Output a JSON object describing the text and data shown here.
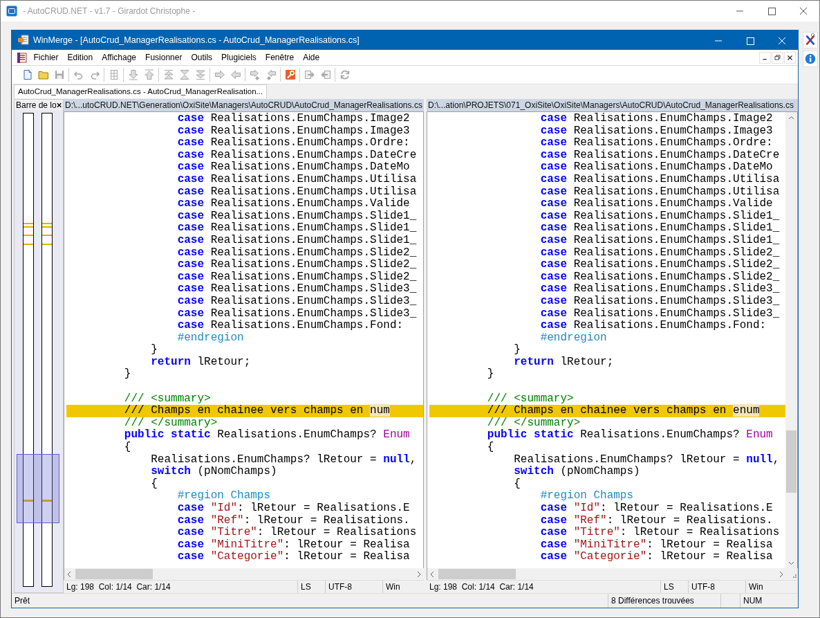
{
  "app_window": {
    "title": "- AutoCRUD.NET - v1.7 - Girardot Christophe -"
  },
  "side_tools": [
    {
      "kind": "tools"
    },
    {
      "kind": "info"
    }
  ],
  "winmerge": {
    "title": "WinMerge - [AutoCrud_ManagerRealisations.cs - AutoCrud_ManagerRealisations.cs]",
    "menu": [
      "Fichier",
      "Edition",
      "Affichage",
      "Fusionner",
      "Outils",
      "Plugiciels",
      "Fenêtre",
      "Aide"
    ],
    "toolbar": [
      [
        {
          "kind": "new",
          "disabled": false
        },
        {
          "kind": "open",
          "disabled": false
        },
        {
          "kind": "save",
          "disabled": true
        }
      ],
      [
        {
          "kind": "undo",
          "disabled": true
        },
        {
          "kind": "redo",
          "disabled": true
        }
      ],
      [
        {
          "kind": "columns",
          "disabled": true
        }
      ],
      [
        {
          "kind": "down",
          "disabled": true
        },
        {
          "kind": "up",
          "disabled": true
        }
      ],
      [
        {
          "kind": "first",
          "disabled": true
        },
        {
          "kind": "current",
          "disabled": true
        },
        {
          "kind": "last",
          "disabled": true
        }
      ],
      [
        {
          "kind": "right",
          "disabled": true
        },
        {
          "kind": "left",
          "disabled": true
        }
      ],
      [
        {
          "kind": "right-next",
          "disabled": true
        },
        {
          "kind": "left-next",
          "disabled": true
        }
      ],
      [
        {
          "kind": "options",
          "disabled": false
        }
      ],
      [
        {
          "kind": "to-right",
          "disabled": true
        },
        {
          "kind": "to-left",
          "disabled": true
        }
      ],
      [
        {
          "kind": "refresh",
          "disabled": true
        }
      ]
    ],
    "tabs": [
      {
        "label": "AutoCrud_ManagerRealisations.cs - AutoCrud_ManagerRealisation...",
        "selected": true
      }
    ],
    "location_pane": {
      "title": "Barre de lo"
    },
    "panes": [
      {
        "path": "D:\\...utoCRUD.NET\\Generation\\OxiSite\\Managers\\AutoCRUD\\AutoCrud_ManagerRealisations.cs",
        "lines": [
          {
            "diff": false,
            "tokens": [
              {
                "kind": "keyword",
                "text": "                case"
              },
              {
                "kind": "plain",
                "text": " Realisations.EnumChamps.Image2"
              }
            ]
          },
          {
            "diff": false,
            "tokens": [
              {
                "kind": "keyword",
                "text": "                case"
              },
              {
                "kind": "plain",
                "text": " Realisations.EnumChamps.Image3"
              }
            ]
          },
          {
            "diff": false,
            "tokens": [
              {
                "kind": "keyword",
                "text": "                case"
              },
              {
                "kind": "plain",
                "text": " Realisations.EnumChamps.Ordre:"
              }
            ]
          },
          {
            "diff": false,
            "tokens": [
              {
                "kind": "keyword",
                "text": "                case"
              },
              {
                "kind": "plain",
                "text": " Realisations.EnumChamps.DateCre"
              }
            ]
          },
          {
            "diff": false,
            "tokens": [
              {
                "kind": "keyword",
                "text": "                case"
              },
              {
                "kind": "plain",
                "text": " Realisations.EnumChamps.DateMo"
              }
            ]
          },
          {
            "diff": false,
            "tokens": [
              {
                "kind": "keyword",
                "text": "                case"
              },
              {
                "kind": "plain",
                "text": " Realisations.EnumChamps.Utilisa"
              }
            ]
          },
          {
            "diff": false,
            "tokens": [
              {
                "kind": "keyword",
                "text": "                case"
              },
              {
                "kind": "plain",
                "text": " Realisations.EnumChamps.Utilisa"
              }
            ]
          },
          {
            "diff": false,
            "tokens": [
              {
                "kind": "keyword",
                "text": "                case"
              },
              {
                "kind": "plain",
                "text": " Realisations.EnumChamps.Valide"
              }
            ]
          },
          {
            "diff": false,
            "tokens": [
              {
                "kind": "keyword",
                "text": "                case"
              },
              {
                "kind": "plain",
                "text": " Realisations.EnumChamps.Slide1_"
              }
            ]
          },
          {
            "diff": false,
            "tokens": [
              {
                "kind": "keyword",
                "text": "                case"
              },
              {
                "kind": "plain",
                "text": " Realisations.EnumChamps.Slide1_"
              }
            ]
          },
          {
            "diff": false,
            "tokens": [
              {
                "kind": "keyword",
                "text": "                case"
              },
              {
                "kind": "plain",
                "text": " Realisations.EnumChamps.Slide1_"
              }
            ]
          },
          {
            "diff": false,
            "tokens": [
              {
                "kind": "keyword",
                "text": "                case"
              },
              {
                "kind": "plain",
                "text": " Realisations.EnumChamps.Slide2_"
              }
            ]
          },
          {
            "diff": false,
            "tokens": [
              {
                "kind": "keyword",
                "text": "                case"
              },
              {
                "kind": "plain",
                "text": " Realisations.EnumChamps.Slide2_"
              }
            ]
          },
          {
            "diff": false,
            "tokens": [
              {
                "kind": "keyword",
                "text": "                case"
              },
              {
                "kind": "plain",
                "text": " Realisations.EnumChamps.Slide2_"
              }
            ]
          },
          {
            "diff": false,
            "tokens": [
              {
                "kind": "keyword",
                "text": "                case"
              },
              {
                "kind": "plain",
                "text": " Realisations.EnumChamps.Slide3_"
              }
            ]
          },
          {
            "diff": false,
            "tokens": [
              {
                "kind": "keyword",
                "text": "                case"
              },
              {
                "kind": "plain",
                "text": " Realisations.EnumChamps.Slide3_"
              }
            ]
          },
          {
            "diff": false,
            "tokens": [
              {
                "kind": "keyword",
                "text": "                case"
              },
              {
                "kind": "plain",
                "text": " Realisations.EnumChamps.Slide3_"
              }
            ]
          },
          {
            "diff": false,
            "tokens": [
              {
                "kind": "keyword",
                "text": "                case"
              },
              {
                "kind": "plain",
                "text": " Realisations.EnumChamps.Fond:"
              }
            ]
          },
          {
            "diff": false,
            "tokens": [
              {
                "kind": "preprocessor",
                "text": "                #endregion"
              }
            ]
          },
          {
            "diff": false,
            "tokens": [
              {
                "kind": "plain",
                "text": "            }"
              }
            ]
          },
          {
            "diff": false,
            "tokens": [
              {
                "kind": "keyword",
                "text": "            return"
              },
              {
                "kind": "plain",
                "text": " lRetour;"
              }
            ]
          },
          {
            "diff": false,
            "tokens": [
              {
                "kind": "plain",
                "text": "        }"
              }
            ]
          },
          {
            "diff": false
          },
          {
            "diff": false,
            "tokens": [
              {
                "kind": "comment",
                "text": "        /// <summary>"
              }
            ]
          },
          {
            "diff": true,
            "tokens": [
              {
                "kind": "comment",
                "text": "        /// Champs en chainee vers champs en "
              },
              {
                "kind": "changed",
                "text": "num"
              }
            ]
          },
          {
            "diff": false,
            "tokens": [
              {
                "kind": "comment",
                "text": "        /// </summary>"
              }
            ]
          },
          {
            "diff": false,
            "tokens": [
              {
                "kind": "keyword",
                "text": "        public static"
              },
              {
                "kind": "plain",
                "text": " Realisations.EnumChamps? "
              },
              {
                "kind": "method",
                "text": "Enum"
              }
            ]
          },
          {
            "diff": false,
            "tokens": [
              {
                "kind": "plain",
                "text": "        {"
              }
            ]
          },
          {
            "diff": false,
            "tokens": [
              {
                "kind": "plain",
                "text": "            Realisations.EnumChamps? lRetour = "
              },
              {
                "kind": "keyword",
                "text": "null"
              },
              {
                "kind": "plain",
                "text": ","
              }
            ]
          },
          {
            "diff": false,
            "tokens": [
              {
                "kind": "keyword",
                "text": "            switch"
              },
              {
                "kind": "plain",
                "text": " (pNomChamps)"
              }
            ]
          },
          {
            "diff": false,
            "tokens": [
              {
                "kind": "plain",
                "text": "            {"
              }
            ]
          },
          {
            "diff": false,
            "tokens": [
              {
                "kind": "preprocessor",
                "text": "                #region Champs"
              }
            ]
          },
          {
            "diff": false,
            "tokens": [
              {
                "kind": "keyword",
                "text": "                case"
              },
              {
                "kind": "string",
                "text": " \"Id\""
              },
              {
                "kind": "plain",
                "text": ": lRetour = Realisations.E"
              }
            ]
          },
          {
            "diff": false,
            "tokens": [
              {
                "kind": "keyword",
                "text": "                case"
              },
              {
                "kind": "string",
                "text": " \"Ref\""
              },
              {
                "kind": "plain",
                "text": ": lRetour = Realisations."
              }
            ]
          },
          {
            "diff": false,
            "tokens": [
              {
                "kind": "keyword",
                "text": "                case"
              },
              {
                "kind": "string",
                "text": " \"Titre\""
              },
              {
                "kind": "plain",
                "text": ": lRetour = Realisations"
              }
            ]
          },
          {
            "diff": false,
            "tokens": [
              {
                "kind": "keyword",
                "text": "                case"
              },
              {
                "kind": "string",
                "text": " \"MiniTitre\""
              },
              {
                "kind": "plain",
                "text": ": lRetour = Realisa"
              }
            ]
          },
          {
            "diff": false,
            "tokens": [
              {
                "kind": "keyword",
                "text": "                case"
              },
              {
                "kind": "string",
                "text": " \"Categorie\""
              },
              {
                "kind": "plain",
                "text": ": lRetour = Realisa"
              }
            ]
          }
        ],
        "status": {
          "position": "Lg: 198  Col: 1/14  Car: 1/14",
          "eol": "LS",
          "encoding": "UTF-8",
          "format": "Win"
        }
      },
      {
        "path": "D:\\...ation\\PROJETS\\071_OxiSite\\OxiSite\\Managers\\AutoCRUD\\AutoCrud_ManagerRealisations.cs",
        "lines": [
          {
            "diff": false,
            "tokens": [
              {
                "kind": "keyword",
                "text": "                case"
              },
              {
                "kind": "plain",
                "text": " Realisations.EnumChamps.Image2"
              }
            ]
          },
          {
            "diff": false,
            "tokens": [
              {
                "kind": "keyword",
                "text": "                case"
              },
              {
                "kind": "plain",
                "text": " Realisations.EnumChamps.Image3"
              }
            ]
          },
          {
            "diff": false,
            "tokens": [
              {
                "kind": "keyword",
                "text": "                case"
              },
              {
                "kind": "plain",
                "text": " Realisations.EnumChamps.Ordre:"
              }
            ]
          },
          {
            "diff": false,
            "tokens": [
              {
                "kind": "keyword",
                "text": "                case"
              },
              {
                "kind": "plain",
                "text": " Realisations.EnumChamps.DateCre"
              }
            ]
          },
          {
            "diff": false,
            "tokens": [
              {
                "kind": "keyword",
                "text": "                case"
              },
              {
                "kind": "plain",
                "text": " Realisations.EnumChamps.DateMo"
              }
            ]
          },
          {
            "diff": false,
            "tokens": [
              {
                "kind": "keyword",
                "text": "                case"
              },
              {
                "kind": "plain",
                "text": " Realisations.EnumChamps.Utilisa"
              }
            ]
          },
          {
            "diff": false,
            "tokens": [
              {
                "kind": "keyword",
                "text": "                case"
              },
              {
                "kind": "plain",
                "text": " Realisations.EnumChamps.Utilisa"
              }
            ]
          },
          {
            "diff": false,
            "tokens": [
              {
                "kind": "keyword",
                "text": "                case"
              },
              {
                "kind": "plain",
                "text": " Realisations.EnumChamps.Valide"
              }
            ]
          },
          {
            "diff": false,
            "tokens": [
              {
                "kind": "keyword",
                "text": "                case"
              },
              {
                "kind": "plain",
                "text": " Realisations.EnumChamps.Slide1_"
              }
            ]
          },
          {
            "diff": false,
            "tokens": [
              {
                "kind": "keyword",
                "text": "                case"
              },
              {
                "kind": "plain",
                "text": " Realisations.EnumChamps.Slide1_"
              }
            ]
          },
          {
            "diff": false,
            "tokens": [
              {
                "kind": "keyword",
                "text": "                case"
              },
              {
                "kind": "plain",
                "text": " Realisations.EnumChamps.Slide1_"
              }
            ]
          },
          {
            "diff": false,
            "tokens": [
              {
                "kind": "keyword",
                "text": "                case"
              },
              {
                "kind": "plain",
                "text": " Realisations.EnumChamps.Slide2_"
              }
            ]
          },
          {
            "diff": false,
            "tokens": [
              {
                "kind": "keyword",
                "text": "                case"
              },
              {
                "kind": "plain",
                "text": " Realisations.EnumChamps.Slide2_"
              }
            ]
          },
          {
            "diff": false,
            "tokens": [
              {
                "kind": "keyword",
                "text": "                case"
              },
              {
                "kind": "plain",
                "text": " Realisations.EnumChamps.Slide2_"
              }
            ]
          },
          {
            "diff": false,
            "tokens": [
              {
                "kind": "keyword",
                "text": "                case"
              },
              {
                "kind": "plain",
                "text": " Realisations.EnumChamps.Slide3_"
              }
            ]
          },
          {
            "diff": false,
            "tokens": [
              {
                "kind": "keyword",
                "text": "                case"
              },
              {
                "kind": "plain",
                "text": " Realisations.EnumChamps.Slide3_"
              }
            ]
          },
          {
            "diff": false,
            "tokens": [
              {
                "kind": "keyword",
                "text": "                case"
              },
              {
                "kind": "plain",
                "text": " Realisations.EnumChamps.Slide3_"
              }
            ]
          },
          {
            "diff": false,
            "tokens": [
              {
                "kind": "keyword",
                "text": "                case"
              },
              {
                "kind": "plain",
                "text": " Realisations.EnumChamps.Fond:"
              }
            ]
          },
          {
            "diff": false,
            "tokens": [
              {
                "kind": "preprocessor",
                "text": "                #endregion"
              }
            ]
          },
          {
            "diff": false,
            "tokens": [
              {
                "kind": "plain",
                "text": "            }"
              }
            ]
          },
          {
            "diff": false,
            "tokens": [
              {
                "kind": "keyword",
                "text": "            return"
              },
              {
                "kind": "plain",
                "text": " lRetour;"
              }
            ]
          },
          {
            "diff": false,
            "tokens": [
              {
                "kind": "plain",
                "text": "        }"
              }
            ]
          },
          {
            "diff": false
          },
          {
            "diff": false,
            "tokens": [
              {
                "kind": "comment",
                "text": "        /// <summary>"
              }
            ]
          },
          {
            "diff": true,
            "tokens": [
              {
                "kind": "comment",
                "text": "        /// Champs en chainee vers champs en "
              },
              {
                "kind": "changed",
                "text": "enum"
              }
            ]
          },
          {
            "diff": false,
            "tokens": [
              {
                "kind": "comment",
                "text": "        /// </summary>"
              }
            ]
          },
          {
            "diff": false,
            "tokens": [
              {
                "kind": "keyword",
                "text": "        public static"
              },
              {
                "kind": "plain",
                "text": " Realisations.EnumChamps? "
              },
              {
                "kind": "method",
                "text": "Enum"
              }
            ]
          },
          {
            "diff": false,
            "tokens": [
              {
                "kind": "plain",
                "text": "        {"
              }
            ]
          },
          {
            "diff": false,
            "tokens": [
              {
                "kind": "plain",
                "text": "            Realisations.EnumChamps? lRetour = "
              },
              {
                "kind": "keyword",
                "text": "null"
              },
              {
                "kind": "plain",
                "text": ","
              }
            ]
          },
          {
            "diff": false,
            "tokens": [
              {
                "kind": "keyword",
                "text": "            switch"
              },
              {
                "kind": "plain",
                "text": " (pNomChamps)"
              }
            ]
          },
          {
            "diff": false,
            "tokens": [
              {
                "kind": "plain",
                "text": "            {"
              }
            ]
          },
          {
            "diff": false,
            "tokens": [
              {
                "kind": "preprocessor",
                "text": "                #region Champs"
              }
            ]
          },
          {
            "diff": false,
            "tokens": [
              {
                "kind": "keyword",
                "text": "                case"
              },
              {
                "kind": "string",
                "text": " \"Id\""
              },
              {
                "kind": "plain",
                "text": ": lRetour = Realisations.E"
              }
            ]
          },
          {
            "diff": false,
            "tokens": [
              {
                "kind": "keyword",
                "text": "                case"
              },
              {
                "kind": "string",
                "text": " \"Ref\""
              },
              {
                "kind": "plain",
                "text": ": lRetour = Realisations."
              }
            ]
          },
          {
            "diff": false,
            "tokens": [
              {
                "kind": "keyword",
                "text": "                case"
              },
              {
                "kind": "string",
                "text": " \"Titre\""
              },
              {
                "kind": "plain",
                "text": ": lRetour = Realisations"
              }
            ]
          },
          {
            "diff": false,
            "tokens": [
              {
                "kind": "keyword",
                "text": "                case"
              },
              {
                "kind": "string",
                "text": " \"MiniTitre\""
              },
              {
                "kind": "plain",
                "text": ": lRetour = Realisa"
              }
            ]
          },
          {
            "diff": false,
            "tokens": [
              {
                "kind": "keyword",
                "text": "                case"
              },
              {
                "kind": "string",
                "text": " \"Categorie\""
              },
              {
                "kind": "plain",
                "text": ": lRetour = Realisa"
              }
            ]
          }
        ],
        "status": {
          "position": "Lg: 198  Col: 1/14  Car: 1/14",
          "eol": "LS",
          "encoding": "UTF-8",
          "format": "Win"
        }
      }
    ],
    "status_bar": {
      "message": "Prêt",
      "differences": "8 Différences trouvées",
      "num": "NUM"
    }
  }
}
